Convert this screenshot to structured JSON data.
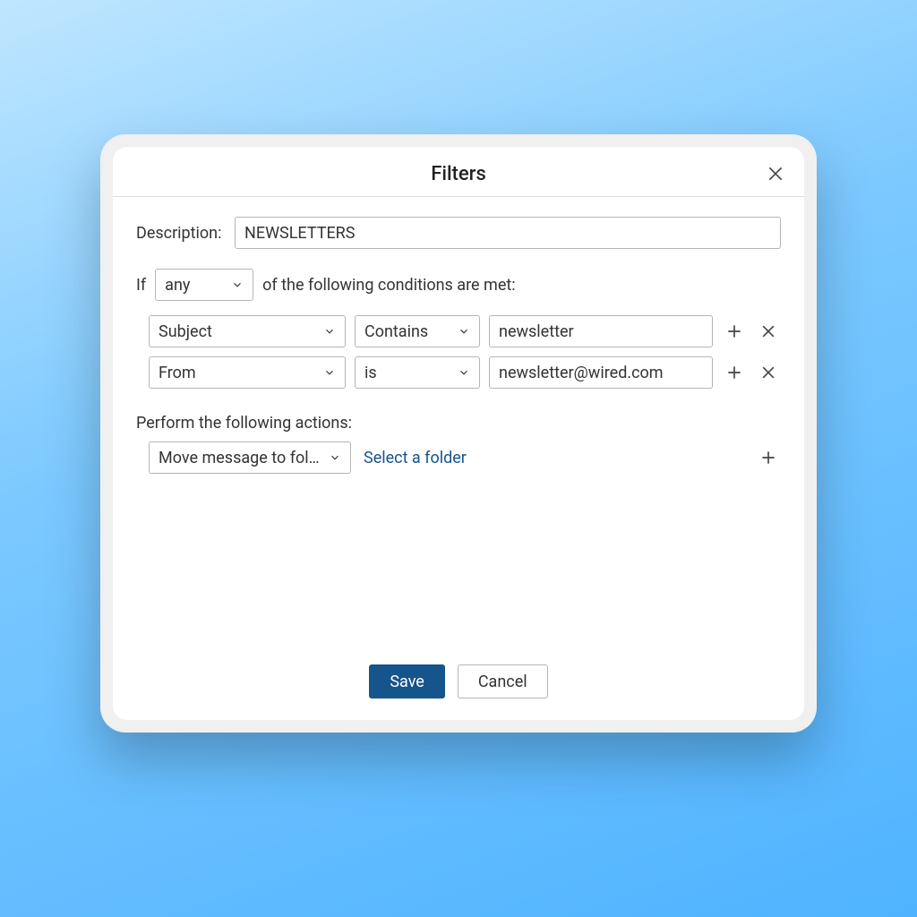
{
  "dialog": {
    "title": "Filters",
    "description_label": "Description:",
    "description_value": "NEWSLETTERS",
    "if_label": "If",
    "match_mode": "any",
    "if_suffix": "of the following conditions are met:",
    "conditions": [
      {
        "field": "Subject",
        "operator": "Contains",
        "value": "newsletter"
      },
      {
        "field": "From",
        "operator": "is",
        "value": "newsletter@wired.com"
      }
    ],
    "actions_label": "Perform the following actions:",
    "action_select": "Move message to fol…",
    "action_link": "Select a folder",
    "save_label": "Save",
    "cancel_label": "Cancel"
  }
}
